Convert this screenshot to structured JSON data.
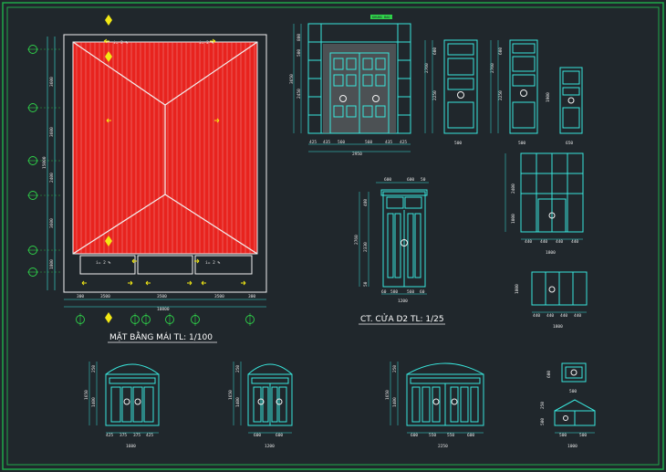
{
  "colors": {
    "background": "#20272c",
    "border": "#1fa84a",
    "cyan": "#39e6dc",
    "red": "#e8231e",
    "white": "#f2f2f2",
    "yellow": "#f2e814",
    "green": "#2fd44a",
    "gray": "#8a8f92"
  },
  "titles": {
    "roof_plan": "MẶT BẰNG MÁI TL: 1/100",
    "door_detail": "CT. CỬA D2 TL: 1/25"
  },
  "roof_plan": {
    "bottom_dims": [
      "300",
      "3500",
      "3500",
      "3500",
      "300"
    ],
    "bottom_total": "10800",
    "left_dims": [
      "3600",
      "3600",
      "2400",
      "3600",
      "1800"
    ],
    "left_total": "15000",
    "slope_labels": [
      "i= 2 %",
      "i= 2 %",
      "i= 2 %",
      "i= 2 %"
    ]
  },
  "door_d1": {
    "label_tag": "KHUNG BAO GỖ",
    "bottom_dims": [
      "425",
      "435",
      "560",
      "560",
      "435",
      "425"
    ],
    "bottom_total": "2950",
    "left_dims": [
      "800",
      "500",
      "2450"
    ],
    "left_total": "3650"
  },
  "door_d2": {
    "top_dims": [
      "600",
      "600",
      "50"
    ],
    "bottom_dims": [
      "60",
      "580",
      "560",
      "60"
    ],
    "bottom_total": "1200",
    "left_dims": [
      "480",
      "2330",
      "50"
    ],
    "left_total": "2760"
  },
  "window_s1": {
    "left_dims": [
      "600",
      "2250"
    ],
    "left_total": "2760",
    "bottom": "500"
  },
  "window_s2": {
    "left_dims": [
      "600",
      "2250"
    ],
    "left_total": "2760",
    "bottom": "500"
  },
  "window_s3": {
    "left": "1900",
    "bottom": "650"
  },
  "glazed_wall": {
    "left_dims": [
      "2400",
      "1000"
    ],
    "bottom_dims": [
      "440",
      "440",
      "440",
      "440"
    ],
    "bottom_total": "1800"
  },
  "glazed_panel": {
    "left": "1000",
    "bottom_dims": [
      "440",
      "440",
      "440",
      "440"
    ],
    "bottom_total": "1800"
  },
  "arched_1": {
    "left_dims": [
      "250",
      "1400"
    ],
    "left_total": "1650",
    "bottom_dims": [
      "425",
      "375",
      "375",
      "425"
    ],
    "bottom_total": "1600"
  },
  "arched_2": {
    "left_dims": [
      "250",
      "1400"
    ],
    "left_total": "1650",
    "bottom_dims": [
      "600",
      "600"
    ],
    "bottom_total": "1200"
  },
  "arched_3": {
    "left_dims": [
      "250",
      "1400"
    ],
    "left_total": "1650",
    "bottom_dims": [
      "600",
      "550",
      "550",
      "600"
    ],
    "bottom_total": "2250"
  },
  "small_window_1": {
    "left": "600",
    "bottom": "500"
  },
  "small_window_2": {
    "left_dims": [
      "250",
      "500"
    ],
    "bottom_dims": [
      "500",
      "500"
    ],
    "bottom_total": "1000"
  }
}
